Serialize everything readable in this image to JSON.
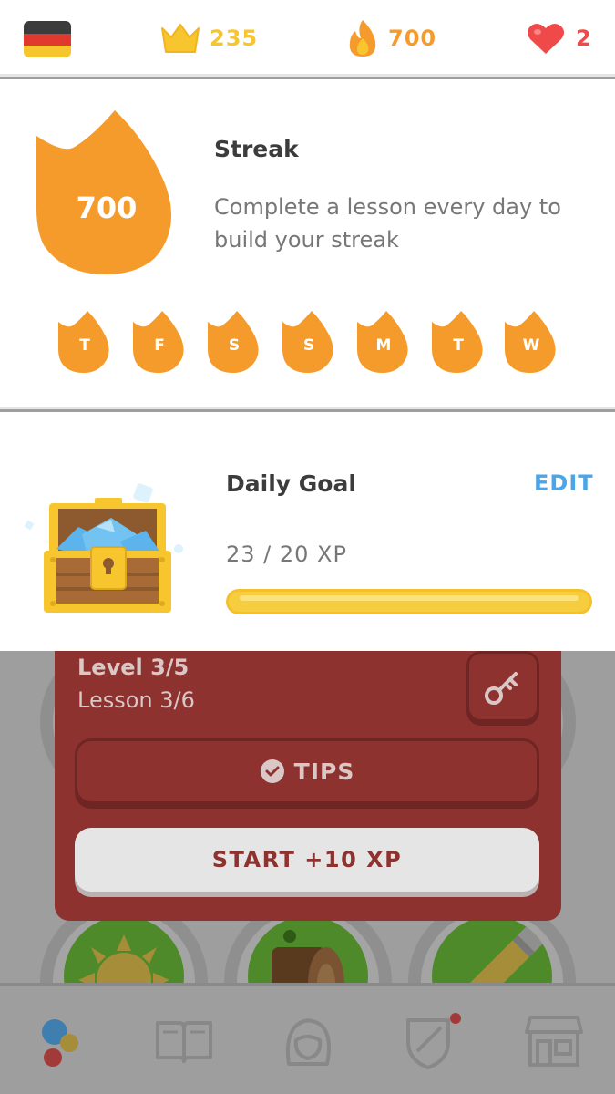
{
  "top_bar": {
    "flag_icon": "germany-flag-icon",
    "crowns": {
      "icon": "crown-icon",
      "value": "235",
      "color": "#f7c62f"
    },
    "streak": {
      "icon": "flame-icon",
      "value": "700",
      "color": "#f49b2c"
    },
    "hearts": {
      "icon": "heart-icon",
      "value": "2",
      "color": "#f0494a"
    }
  },
  "streak_panel": {
    "count": "700",
    "title": "Streak",
    "description": "Complete a lesson every day to build your streak",
    "days": [
      "T",
      "F",
      "S",
      "S",
      "M",
      "T",
      "W"
    ],
    "flame_color": "#f49b2c"
  },
  "daily_goal": {
    "title": "Daily Goal",
    "edit_label": "EDIT",
    "progress_text": "23 / 20 XP",
    "progress_fraction": 1.0,
    "bar_color": "#f6cd3e"
  },
  "lesson_popup": {
    "level": "Level 3/5",
    "lesson": "Lesson 3/6",
    "tips_label": "TIPS",
    "start_label": "START +10 XP",
    "key_icon": "key-icon",
    "card_color": "#8e3230"
  },
  "skills": [
    {
      "icon": "sun-icon"
    },
    {
      "icon": "log-icon"
    },
    {
      "icon": "pencil-icon"
    }
  ],
  "bottom_nav": [
    {
      "icon": "learn-icon"
    },
    {
      "icon": "stories-icon"
    },
    {
      "icon": "profile-icon"
    },
    {
      "icon": "leaderboard-shield-icon"
    },
    {
      "icon": "shop-icon"
    }
  ]
}
